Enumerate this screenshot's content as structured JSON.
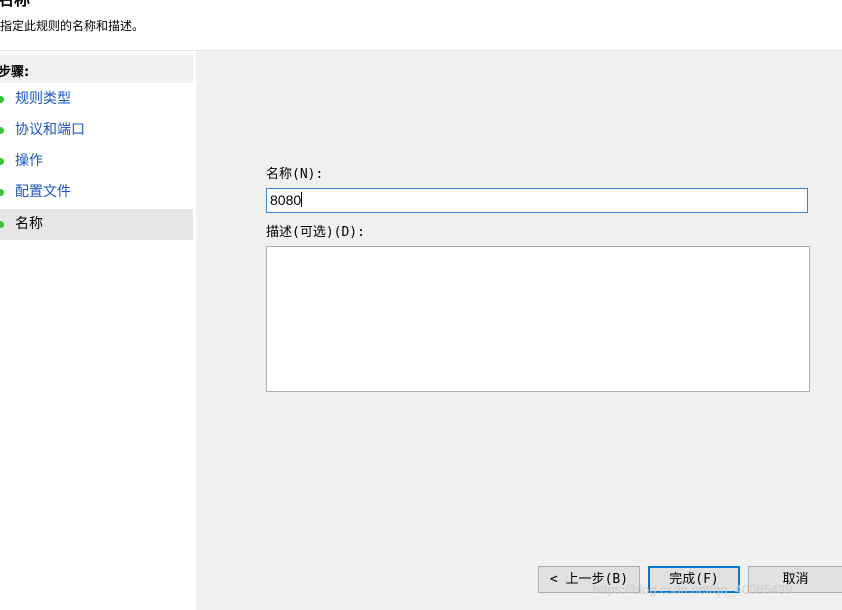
{
  "header": {
    "title": "名称",
    "description": "指定此规则的名称和描述。"
  },
  "steps": {
    "heading": "步骤:",
    "items": [
      {
        "label": "规则类型",
        "active": false
      },
      {
        "label": "协议和端口",
        "active": false
      },
      {
        "label": "操作",
        "active": false
      },
      {
        "label": "配置文件",
        "active": false
      },
      {
        "label": "名称",
        "active": true
      }
    ],
    "dot_color": "#3fbf3f",
    "link_color": "#1a56c4"
  },
  "form": {
    "name_label": "名称(N):",
    "name_value": "8080",
    "description_label": "描述(可选)(D):",
    "description_value": ""
  },
  "buttons": {
    "back": "< 上一步(B)",
    "finish": "完成(F)",
    "cancel": "取消"
  },
  "watermark": "https://blog.csdn.net/qq_40085439"
}
